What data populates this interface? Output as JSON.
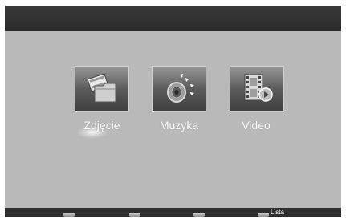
{
  "menu": {
    "items": [
      {
        "label": "Zdjęcie",
        "icon": "photo-folder-icon"
      },
      {
        "label": "Muzyka",
        "icon": "speaker-icon"
      },
      {
        "label": "Video",
        "icon": "film-play-icon"
      }
    ],
    "selected": "Zdjęcie"
  },
  "footer": {
    "lista_label": "Lista",
    "key_names": [
      "red-key-icon",
      "green-key-icon",
      "yellow-key-icon",
      "blue-key-icon"
    ]
  },
  "colors": {
    "background": "#b9b9b9",
    "bar": "#2e2e2e",
    "tile": "#5f5f5f",
    "label": "#ffffff"
  }
}
